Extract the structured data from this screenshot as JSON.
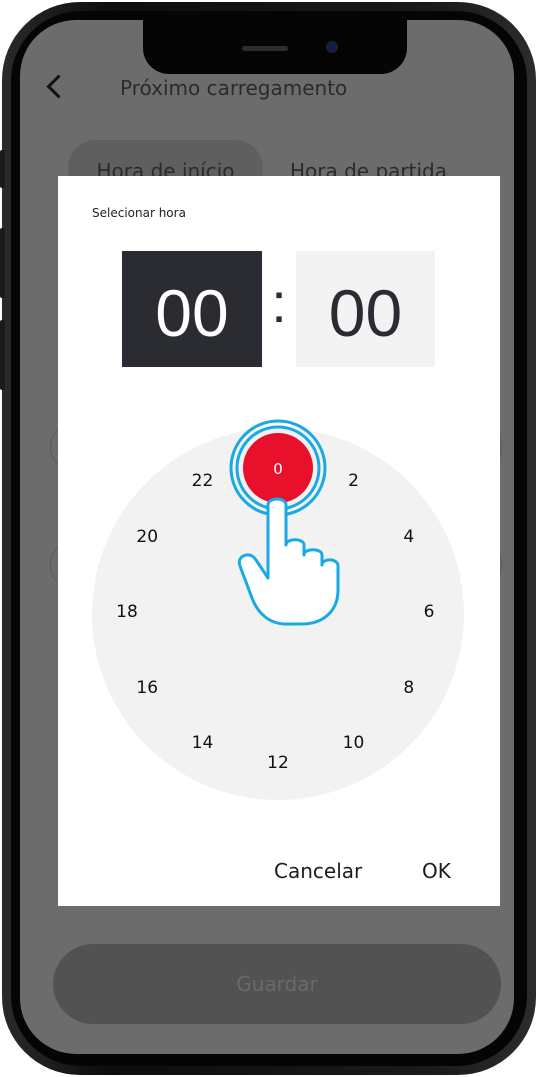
{
  "app": {
    "title": "Próximo carregamento",
    "tabs": [
      {
        "label": "Hora de início",
        "active": true
      },
      {
        "label": "Hora de partida",
        "active": false
      }
    ],
    "save_label": "Guardar"
  },
  "dialog": {
    "title": "Selecionar hora",
    "hour": "00",
    "separator": ":",
    "minute": "00",
    "dial_numbers": [
      "0",
      "2",
      "4",
      "6",
      "8",
      "10",
      "12",
      "14",
      "16",
      "18",
      "20",
      "22"
    ],
    "selected_value": "0",
    "cancel_label": "Cancelar",
    "ok_label": "OK"
  },
  "colors": {
    "selected": "#e8102a",
    "hand_outline": "#1aa9e3",
    "hour_box": "#2b2c31",
    "dial_bg": "#f2f2f2",
    "overlay": "#6c6c6c"
  },
  "icons": [
    "back-arrow-icon",
    "tap-hand-icon"
  ]
}
